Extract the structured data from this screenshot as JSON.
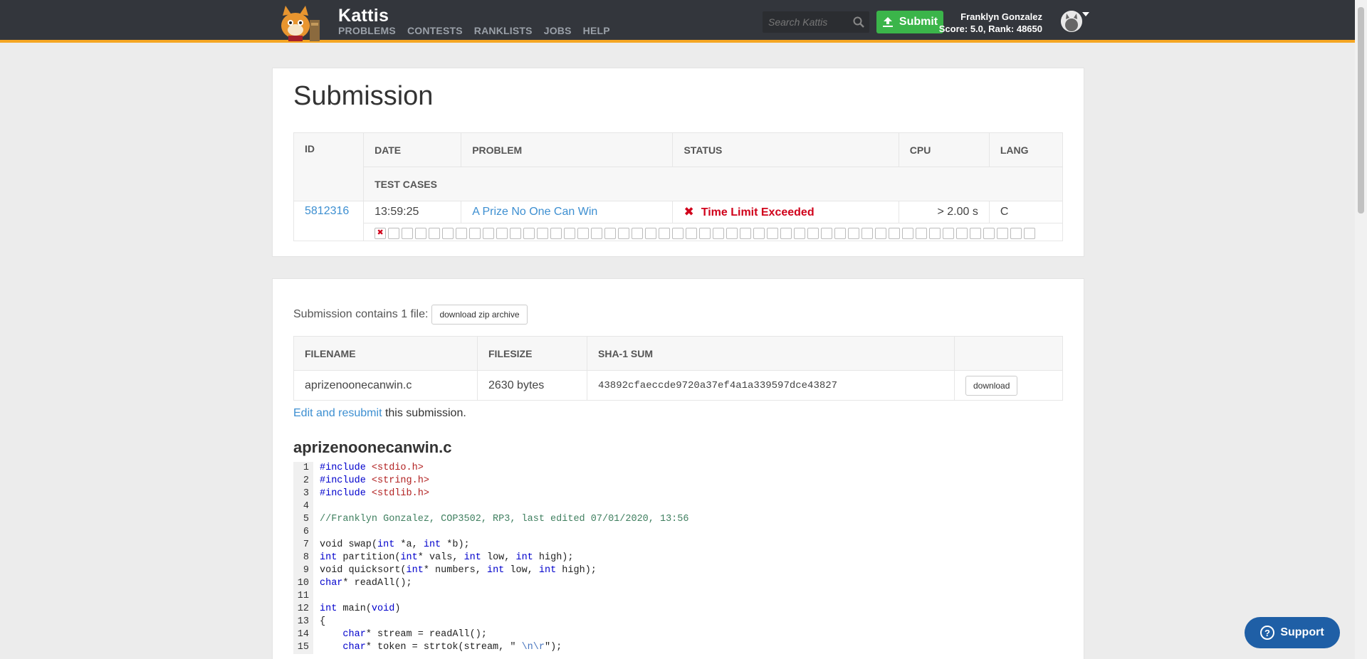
{
  "header": {
    "brand": "Kattis",
    "nav": [
      "PROBLEMS",
      "CONTESTS",
      "RANKLISTS",
      "JOBS",
      "HELP"
    ],
    "search_placeholder": "Search Kattis",
    "submit_label": "Submit",
    "user_name": "Franklyn Gonzalez",
    "user_stats": "Score: 5.0, Rank: 48650"
  },
  "submission": {
    "title": "Submission",
    "headers": {
      "id": "ID",
      "date": "DATE",
      "problem": "PROBLEM",
      "status": "STATUS",
      "cpu": "CPU",
      "lang": "LANG",
      "test_cases": "TEST CASES"
    },
    "id": "5812316",
    "date": "13:59:25",
    "problem": "A Prize No One Can Win",
    "status": "Time Limit Exceeded",
    "cpu": "> 2.00 s",
    "lang": "C",
    "test_case_count": 49,
    "failed_test_index": 0
  },
  "files": {
    "intro": "Submission contains 1 file:",
    "zip_button": "download zip archive",
    "headers": {
      "filename": "FILENAME",
      "filesize": "FILESIZE",
      "sha": "SHA-1 SUM"
    },
    "filename": "aprizenoonecanwin.c",
    "filesize": "2630 bytes",
    "sha": "43892cfaeccde9720a37ef4a1a339597dce43827",
    "download_button": "download",
    "edit_link": "Edit and resubmit",
    "edit_suffix": " this submission.",
    "code_title": "aprizenoonecanwin.c"
  },
  "code_lines": [
    {
      "n": "1",
      "parts": [
        [
          "kw",
          "#include "
        ],
        [
          "str",
          "<stdio.h>"
        ]
      ]
    },
    {
      "n": "2",
      "parts": [
        [
          "kw",
          "#include "
        ],
        [
          "str",
          "<string.h>"
        ]
      ]
    },
    {
      "n": "3",
      "parts": [
        [
          "kw",
          "#include "
        ],
        [
          "str",
          "<stdlib.h>"
        ]
      ]
    },
    {
      "n": "4",
      "parts": []
    },
    {
      "n": "5",
      "parts": [
        [
          "cm",
          "//Franklyn Gonzalez, COP3502, RP3, last edited 07/01/2020, 13:56"
        ]
      ]
    },
    {
      "n": "6",
      "parts": []
    },
    {
      "n": "7",
      "parts": [
        [
          "",
          "void swap("
        ],
        [
          "kw",
          "int"
        ],
        [
          "",
          " *a, "
        ],
        [
          "kw",
          "int"
        ],
        [
          "",
          " *b);"
        ]
      ]
    },
    {
      "n": "8",
      "parts": [
        [
          "kw",
          "int"
        ],
        [
          "",
          " partition("
        ],
        [
          "kw",
          "int"
        ],
        [
          "",
          "* vals, "
        ],
        [
          "kw",
          "int"
        ],
        [
          "",
          " low, "
        ],
        [
          "kw",
          "int"
        ],
        [
          "",
          " high);"
        ]
      ]
    },
    {
      "n": "9",
      "parts": [
        [
          "",
          "void quicksort("
        ],
        [
          "kw",
          "int"
        ],
        [
          "",
          "* numbers, "
        ],
        [
          "kw",
          "int"
        ],
        [
          "",
          " low, "
        ],
        [
          "kw",
          "int"
        ],
        [
          "",
          " high);"
        ]
      ]
    },
    {
      "n": "10",
      "parts": [
        [
          "kw",
          "char"
        ],
        [
          "",
          "* readAll();"
        ]
      ]
    },
    {
      "n": "11",
      "parts": []
    },
    {
      "n": "12",
      "parts": [
        [
          "kw",
          "int"
        ],
        [
          "",
          " main("
        ],
        [
          "kw",
          "void"
        ],
        [
          "",
          ")"
        ]
      ]
    },
    {
      "n": "13",
      "parts": [
        [
          "",
          "{"
        ]
      ]
    },
    {
      "n": "14",
      "parts": [
        [
          "",
          "    "
        ],
        [
          "kw",
          "char"
        ],
        [
          "",
          "* stream = readAll();"
        ]
      ]
    },
    {
      "n": "15",
      "parts": [
        [
          "",
          "    "
        ],
        [
          "kw",
          "char"
        ],
        [
          "",
          "* token = strtok(stream, \" "
        ],
        [
          "esc",
          "\\n\\r"
        ],
        [
          "",
          "\");"
        ]
      ]
    }
  ],
  "support_label": "Support"
}
